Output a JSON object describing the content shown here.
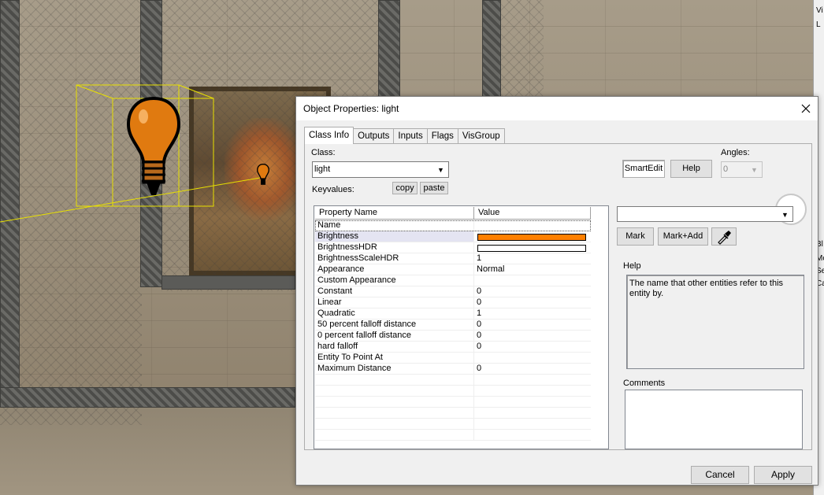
{
  "viewport": {
    "description_icon": "light-bulb-icon"
  },
  "side_window": {
    "fragments": [
      "Vi",
      "L",
      "Bl",
      "Mo",
      "Se",
      "Ca"
    ]
  },
  "dialog": {
    "title": "Object Properties: light",
    "tabs": [
      {
        "label": "Class Info",
        "active": true
      },
      {
        "label": "Outputs",
        "active": false
      },
      {
        "label": "Inputs",
        "active": false
      },
      {
        "label": "Flags",
        "active": false
      },
      {
        "label": "VisGroup",
        "active": false
      }
    ],
    "class_label": "Class:",
    "class_value": "light",
    "keyvalues_label": "Keyvalues:",
    "copy_label": "copy",
    "paste_label": "paste",
    "smartedit_label": "SmartEdit",
    "help_button_label": "Help",
    "angles_label": "Angles:",
    "angles_value": "0",
    "property_header": "Property Name",
    "value_header": "Value",
    "properties": [
      {
        "name": "Name",
        "value": ""
      },
      {
        "name": "Brightness",
        "value": "",
        "color": "#ff8000"
      },
      {
        "name": "BrightnessHDR",
        "value": "",
        "color": "#ffffff"
      },
      {
        "name": "BrightnessScaleHDR",
        "value": "1"
      },
      {
        "name": "Appearance",
        "value": "Normal"
      },
      {
        "name": "Custom Appearance",
        "value": ""
      },
      {
        "name": "Constant",
        "value": "0"
      },
      {
        "name": "Linear",
        "value": "0"
      },
      {
        "name": "Quadratic",
        "value": "1"
      },
      {
        "name": "50 percent falloff distance",
        "value": "0"
      },
      {
        "name": "0 percent falloff distance",
        "value": "0"
      },
      {
        "name": "hard falloff",
        "value": "0"
      },
      {
        "name": "Entity To Point At",
        "value": ""
      },
      {
        "name": "Maximum Distance",
        "value": "0"
      }
    ],
    "value_combo": "",
    "mark_label": "Mark",
    "mark_add_label": "Mark+Add",
    "help_label": "Help",
    "help_text": "The name that other entities refer to this entity by.",
    "comments_label": "Comments",
    "cancel_label": "Cancel",
    "apply_label": "Apply"
  },
  "colors": {
    "brightness": "#ff8000",
    "selection": "#e4e4f2",
    "focus": "#0078d7"
  }
}
